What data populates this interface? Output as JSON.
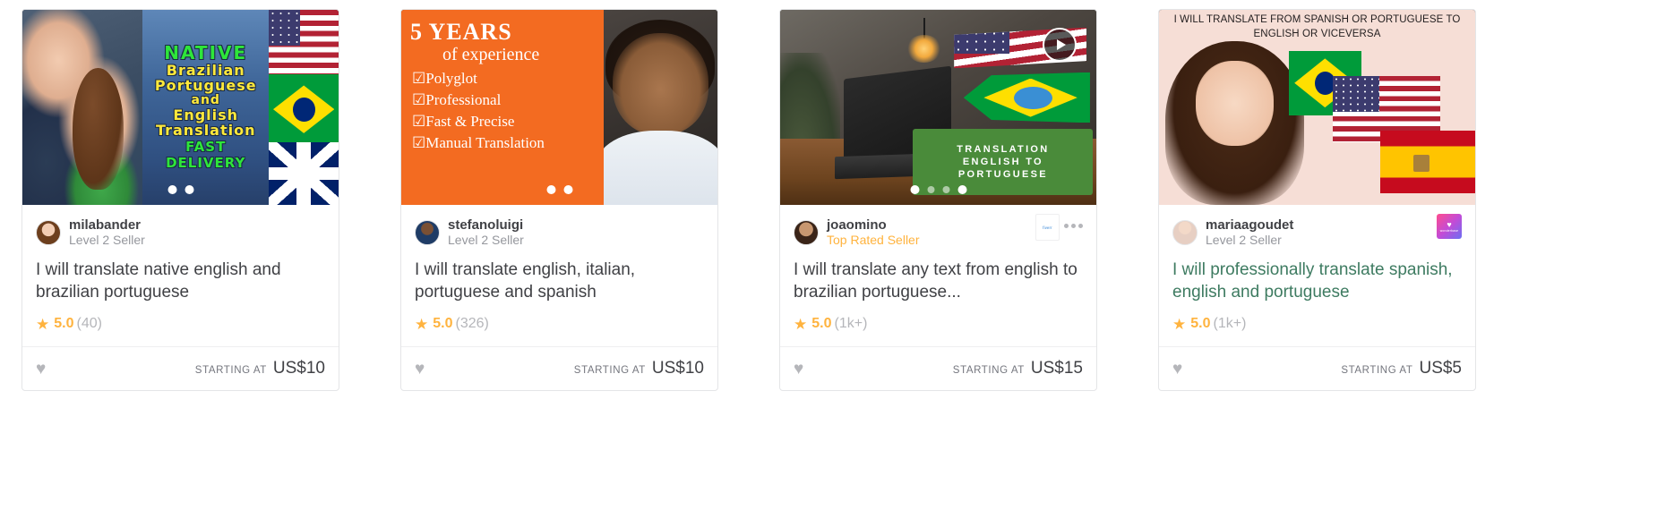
{
  "meta": {
    "labels": {
      "starting_at": "STARTING AT",
      "star_glyph": "★",
      "heart_glyph": "♥"
    }
  },
  "cards": [
    {
      "seller": "milabander",
      "level": "Level 2 Seller",
      "title": "I will translate native english and brazilian portuguese",
      "rating": "5.0",
      "reviews": "(40)",
      "starting_at": "STARTING AT",
      "price": "US$10",
      "thumb_text": {
        "line1": "NATIVE",
        "line2": "Brazilian",
        "line3": "Portuguese",
        "line4": "and",
        "line5": "English",
        "line6": "Translation",
        "line7": "FAST",
        "line8": "DELIVERY"
      }
    },
    {
      "seller": "stefanoluigi",
      "level": "Level 2 Seller",
      "title": "I will translate english, italian, portuguese and spanish",
      "rating": "5.0",
      "reviews": "(326)",
      "starting_at": "STARTING AT",
      "price": "US$10",
      "thumb_text": {
        "headline": "5 YEARS",
        "subhead": "of experience",
        "b1": "☑Polyglot",
        "b2": "☑Professional",
        "b3": "☑Fast & Precise",
        "b4": "☑Manual Translation"
      }
    },
    {
      "seller": "joaomino",
      "level": "Top Rated Seller",
      "title": "I will translate any text from english to brazilian portuguese...",
      "rating": "5.0",
      "reviews": "(1k+)",
      "starting_at": "STARTING AT",
      "price": "US$15",
      "thumb_text": {
        "tag1": "TRANSLATION",
        "tag2": "ENGLISH TO",
        "tag3": "PORTUGUESE"
      },
      "badge_label": "fiverr",
      "has_video": true,
      "dots": 4,
      "active_dot": 0
    },
    {
      "seller": "mariaagoudet",
      "level": "Level 2 Seller",
      "title": "I will professionally translate spanish, english and portuguese",
      "title_visited": true,
      "rating": "5.0",
      "reviews": "(1k+)",
      "starting_at": "STARTING AT",
      "price": "US$5",
      "thumb_text": {
        "caption": "I WILL TRANSLATE FROM SPANISH OR PORTUGUESE TO ENGLISH OR VICEVERSA"
      },
      "badge_label": "wonderbase"
    }
  ],
  "colors": {
    "accent_orange": "#ffb33e",
    "text_primary": "#404145",
    "text_muted": "#95979d",
    "visited_link": "#3e7b61",
    "border": "#e4e5e7"
  }
}
